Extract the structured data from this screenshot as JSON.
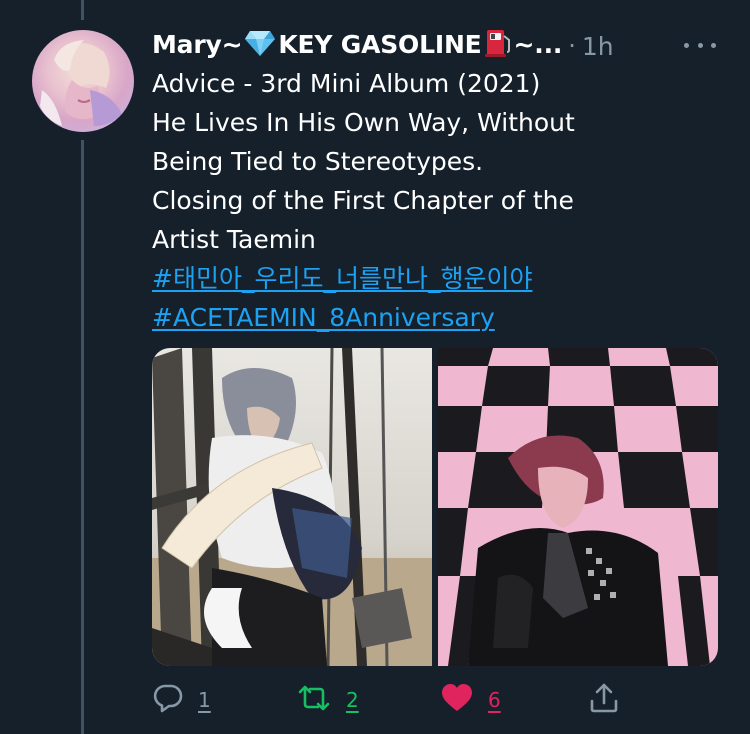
{
  "tweet": {
    "display_name": "Mary~",
    "display_name_mid": "KEY GASOLINE",
    "display_name_end": "~...",
    "separator": "·",
    "time": "1h",
    "text_lines": [
      "Advice - 3rd Mini Album (2021)",
      "He Lives In His Own Way, Without",
      "Being Tied to Stereotypes.",
      "Closing of the First Chapter of the",
      "Artist Taemin"
    ],
    "hashtags": [
      "#태민아_우리도_너를만나_행운이야",
      "#ACETAEMIN_8Anniversary"
    ],
    "media": [
      {
        "icon": "photo-swing-icon"
      },
      {
        "icon": "photo-checkerboard-icon"
      }
    ]
  },
  "actions": {
    "reply_count": "1",
    "retweet_count": "2",
    "like_count": "6"
  },
  "colors": {
    "background": "#15202b",
    "muted": "#8899a6",
    "link": "#1da1f2",
    "retweet": "#17bf63",
    "like": "#e0245e"
  }
}
